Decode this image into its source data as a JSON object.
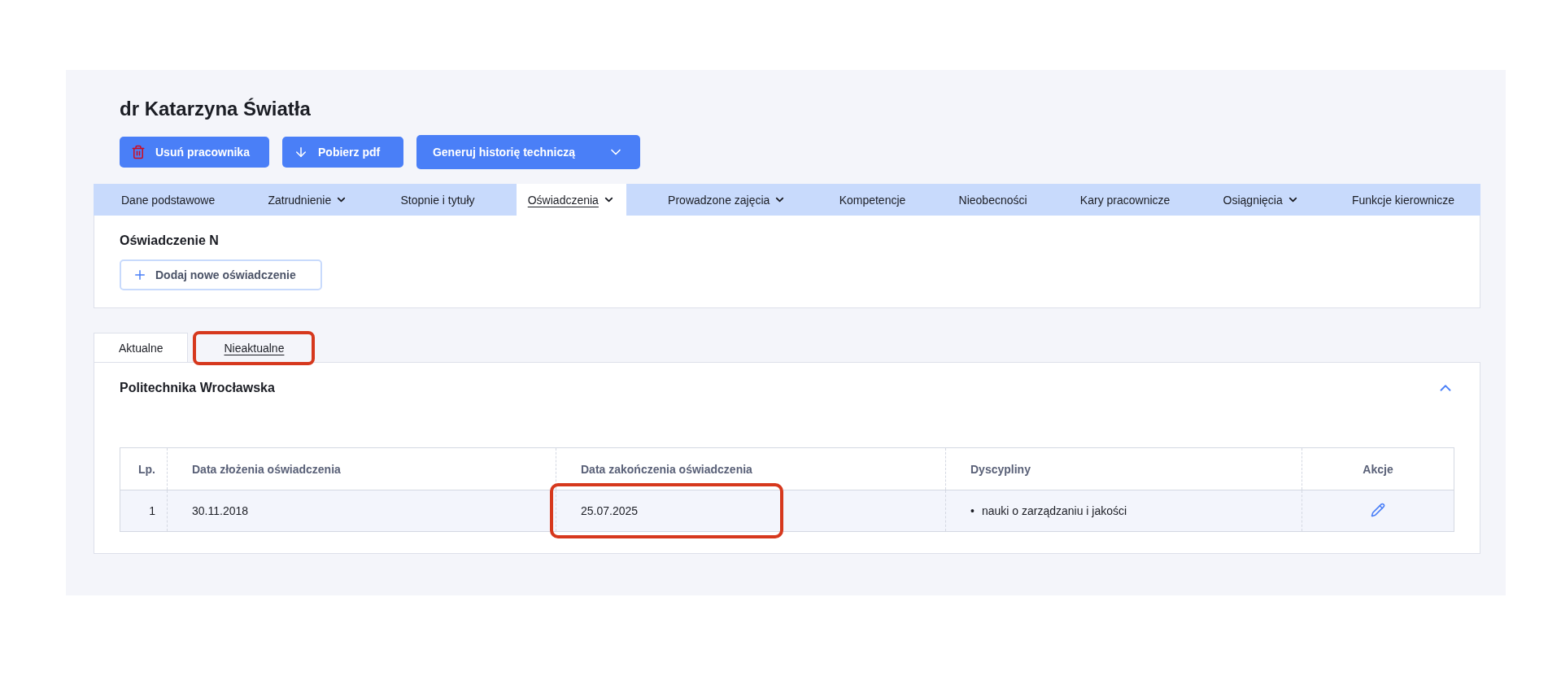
{
  "title": "dr Katarzyna Światła",
  "actions": [
    {
      "kind": "delete",
      "label": "Usuń pracownika"
    },
    {
      "kind": "download",
      "label": "Pobierz pdf"
    },
    {
      "kind": "menu",
      "label": "Generuj historię techniczą"
    }
  ],
  "nav": [
    {
      "label": "Dane podstawowe",
      "dropdown": false,
      "selected": false
    },
    {
      "label": "Zatrudnienie",
      "dropdown": true,
      "selected": false
    },
    {
      "label": "Stopnie i tytuły",
      "dropdown": false,
      "selected": false
    },
    {
      "label": "Oświadczenia",
      "dropdown": true,
      "selected": true
    },
    {
      "label": "Prowadzone zajęcia",
      "dropdown": true,
      "selected": false
    },
    {
      "label": "Kompetencje",
      "dropdown": false,
      "selected": false
    },
    {
      "label": "Nieobecności",
      "dropdown": false,
      "selected": false
    },
    {
      "label": "Kary pracownicze",
      "dropdown": false,
      "selected": false
    },
    {
      "label": "Osiągnięcia",
      "dropdown": true,
      "selected": false
    },
    {
      "label": "Funkcje kierownicze",
      "dropdown": false,
      "selected": false
    }
  ],
  "section": {
    "title": "Oświadczenie N",
    "add_button": "Dodaj nowe oświadczenie"
  },
  "subtabs": [
    {
      "label": "Aktualne",
      "selected": false,
      "highlighted": false
    },
    {
      "label": "Nieaktualne",
      "selected": true,
      "highlighted": true
    }
  ],
  "group": {
    "title": "Politechnika Wrocławska",
    "expanded": true
  },
  "table": {
    "columns": [
      "Lp.",
      "Data złożenia oświadczenia",
      "Data zakończenia oświadczenia",
      "Dyscypliny",
      "Akcje"
    ],
    "rows": [
      {
        "lp": "1",
        "submitted": "30.11.2018",
        "ended": "25.07.2025",
        "ended_highlighted": true,
        "disciplines": [
          {
            "marker": "•",
            "text": "nauki o zarządzaniu i jakości"
          }
        ]
      }
    ]
  }
}
